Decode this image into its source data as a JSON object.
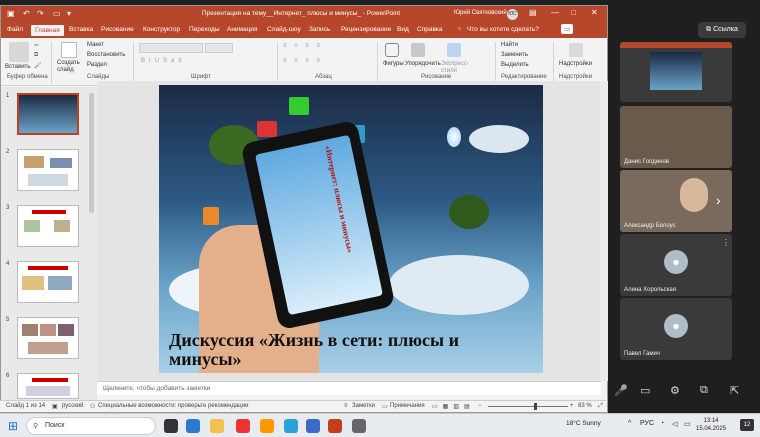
{
  "window": {
    "title": "Презентация на тему__Интернет_ плюсы и минусы_ - PowerPoint",
    "user": "Юрий Святковский",
    "user_initials": "ЮС"
  },
  "tabs": [
    "Файл",
    "Главная",
    "Вставка",
    "Рисование",
    "Конструктор",
    "Переходы",
    "Анимация",
    "Слайд-шоу",
    "Запись",
    "Рецензирование",
    "Вид",
    "Справка"
  ],
  "active_tab": "Главная",
  "tell_me": "Что вы хотите сделать?",
  "ribbon": {
    "paste": "Вставить",
    "new_slide": "Создать слайд",
    "layout": "Макет",
    "reset": "Восстановить",
    "section": "Раздел",
    "groups": [
      "Буфер обмена",
      "Слайды",
      "Шрифт",
      "Абзац",
      "Рисование",
      "Редактирование",
      "Надстройки"
    ],
    "shapes": "Фигуры",
    "arrange": "Упорядочить",
    "quick_styles": "Экспресс-стили",
    "find": "Найти",
    "replace": "Заменить",
    "select": "Выделить",
    "addins": "Надстройки"
  },
  "thumbnails": [
    "1",
    "2",
    "3",
    "4",
    "5",
    "6"
  ],
  "slide": {
    "title": "Дискуссия «Жизнь в сети: плюсы и минусы»",
    "phone_text": "«Интернет: плюсы и минусы»"
  },
  "notes_placeholder": "Щелкните, чтобы добавить заметки",
  "status": {
    "slide_counter": "Слайд 1 из 14",
    "language": "русский",
    "accessibility": "Специальные возможности: проверьте рекомендации",
    "notes": "Заметки",
    "comments": "Примечания",
    "zoom": "83 %"
  },
  "meeting": {
    "link_button": "Ссылка",
    "participants": [
      {
        "name": "Данис Голдинов"
      },
      {
        "name": "Александр Белоус"
      },
      {
        "name": "Алина Хорольская"
      },
      {
        "name": "Павел Гамич"
      }
    ]
  },
  "taskbar": {
    "search_placeholder": "Поиск",
    "weather": "18°C  Sunny",
    "lang": "РУС",
    "time": "13:14",
    "date": "15.04.2025",
    "notifications": "12"
  }
}
